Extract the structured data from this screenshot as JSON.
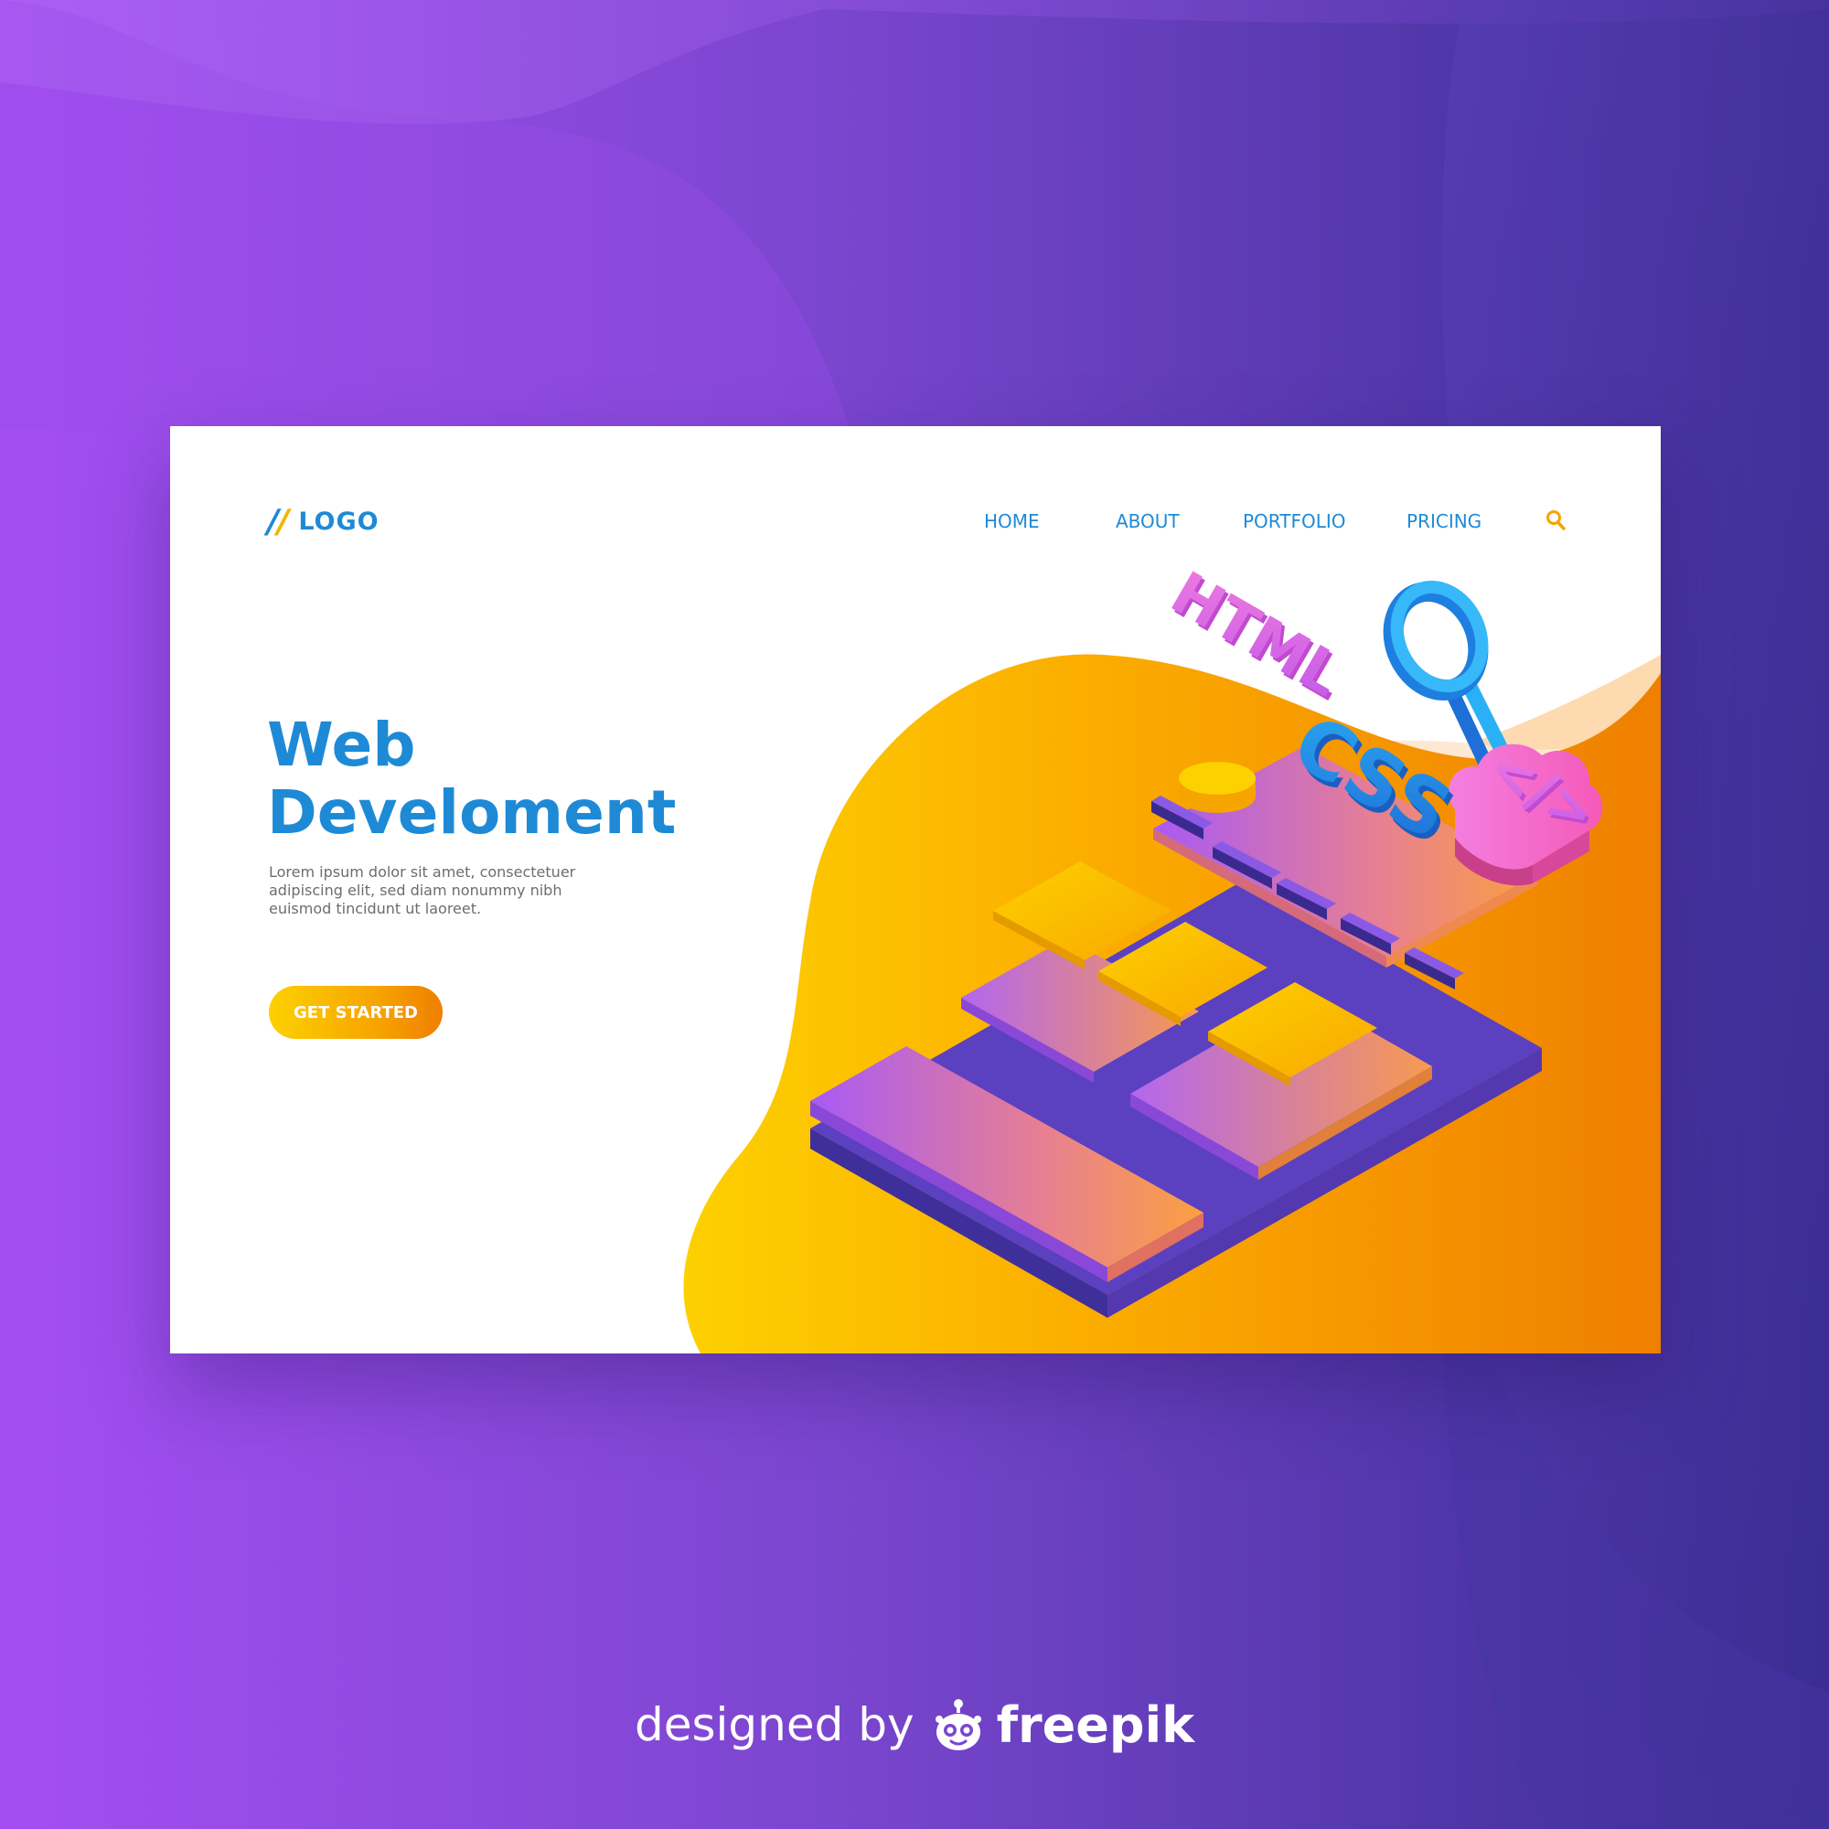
{
  "header": {
    "logo_text": "LOGO",
    "nav": [
      {
        "label": "HOME"
      },
      {
        "label": "ABOUT"
      },
      {
        "label": "PORTFOLIO"
      },
      {
        "label": "PRICING"
      }
    ],
    "search_icon": "search-icon"
  },
  "hero": {
    "title_line1": "Web",
    "title_line2": "Develoment",
    "description": "Lorem ipsum dolor sit amet, consectetuer adipiscing elit, sed diam nonummy nibh euismod tincidunt ut laoreet.",
    "cta_label": "GET STARTED"
  },
  "illustration": {
    "labels": {
      "html": "HTML",
      "css": "CSS",
      "code": "</>"
    }
  },
  "footer": {
    "text": "designed by",
    "brand": "freepik"
  },
  "colors": {
    "primary_blue": "#1e8ad6",
    "accent_yellow": "#f5b400",
    "accent_orange": "#ef7f00",
    "purple": "#8a4fe0",
    "pink": "#f06ac8"
  }
}
